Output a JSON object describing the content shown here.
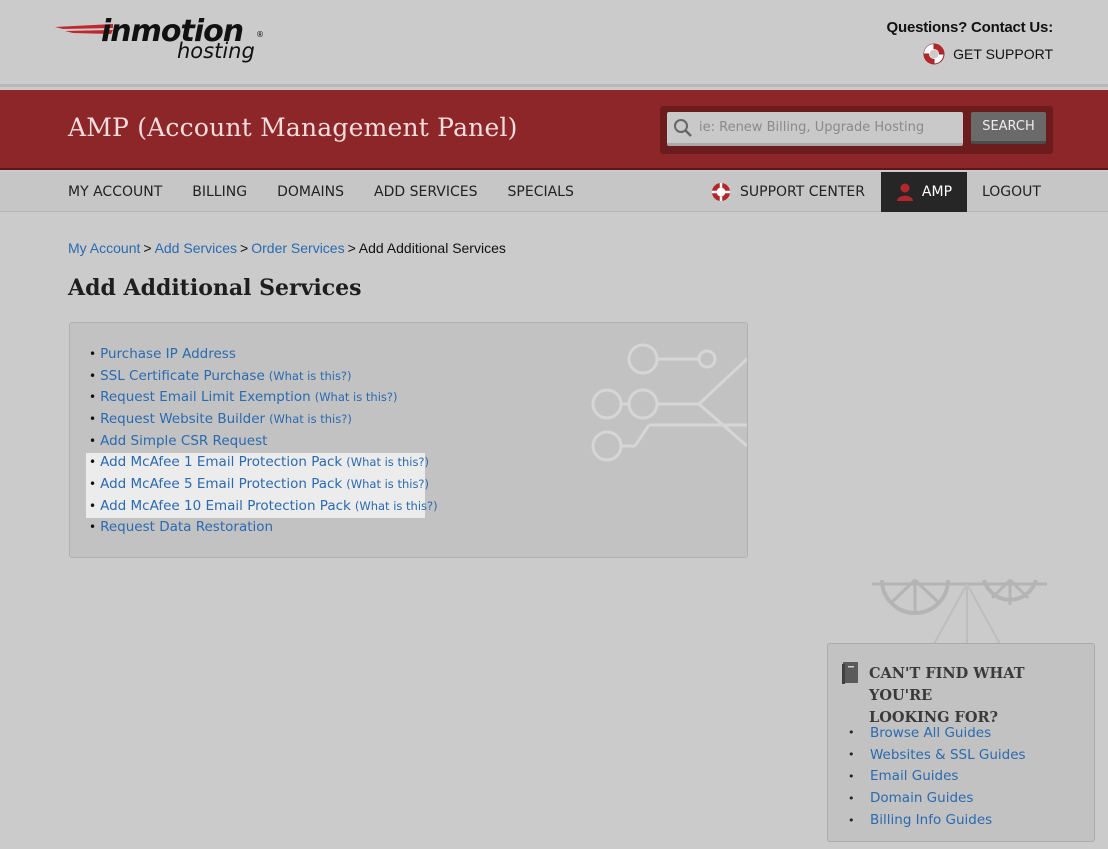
{
  "brand": {
    "name_main": "inmotion",
    "name_sub": "hosting",
    "registered_mark": "®"
  },
  "contact": {
    "question": "Questions? Contact Us:",
    "support_label": "GET SUPPORT"
  },
  "banner": {
    "title": "AMP (Account Management Panel)",
    "search_placeholder": "ie: Renew Billing, Upgrade Hosting",
    "search_button": "SEARCH"
  },
  "nav": {
    "items": [
      "MY ACCOUNT",
      "BILLING",
      "DOMAINS",
      "ADD SERVICES",
      "SPECIALS"
    ],
    "support_center": "SUPPORT CENTER",
    "amp": "AMP",
    "logout": "LOGOUT"
  },
  "breadcrumb": {
    "links": [
      "My Account",
      "Add Services",
      "Order Services"
    ],
    "separator": ">",
    "current": "Add Additional Services"
  },
  "page": {
    "title": "Add Additional Services"
  },
  "services": [
    {
      "label": "Purchase IP Address",
      "what": ""
    },
    {
      "label": "SSL Certificate Purchase",
      "what": "(What is this?)"
    },
    {
      "label": "Request Email Limit Exemption",
      "what": "(What is this?)"
    },
    {
      "label": "Request Website Builder",
      "what": "(What is this?)"
    },
    {
      "label": "Add Simple CSR Request",
      "what": ""
    },
    {
      "label": "Add McAfee 1 Email Protection Pack",
      "what": "(What is this?)"
    },
    {
      "label": "Add McAfee 5 Email Protection Pack",
      "what": "(What is this?)"
    },
    {
      "label": "Add McAfee 10 Email Protection Pack",
      "what": "(What is this?)"
    },
    {
      "label": "Request Data Restoration",
      "what": ""
    }
  ],
  "help": {
    "title_line1": "CAN'T FIND WHAT YOU'RE",
    "title_line2": "LOOKING FOR?",
    "links": [
      "Browse All Guides",
      "Websites & SSL Guides",
      "Email Guides",
      "Domain Guides",
      "Billing Info Guides"
    ]
  },
  "colors": {
    "banner": "#8d2629",
    "link": "#2a6ab0",
    "page_bg": "#cbcbcb",
    "nav_active": "#262626"
  }
}
